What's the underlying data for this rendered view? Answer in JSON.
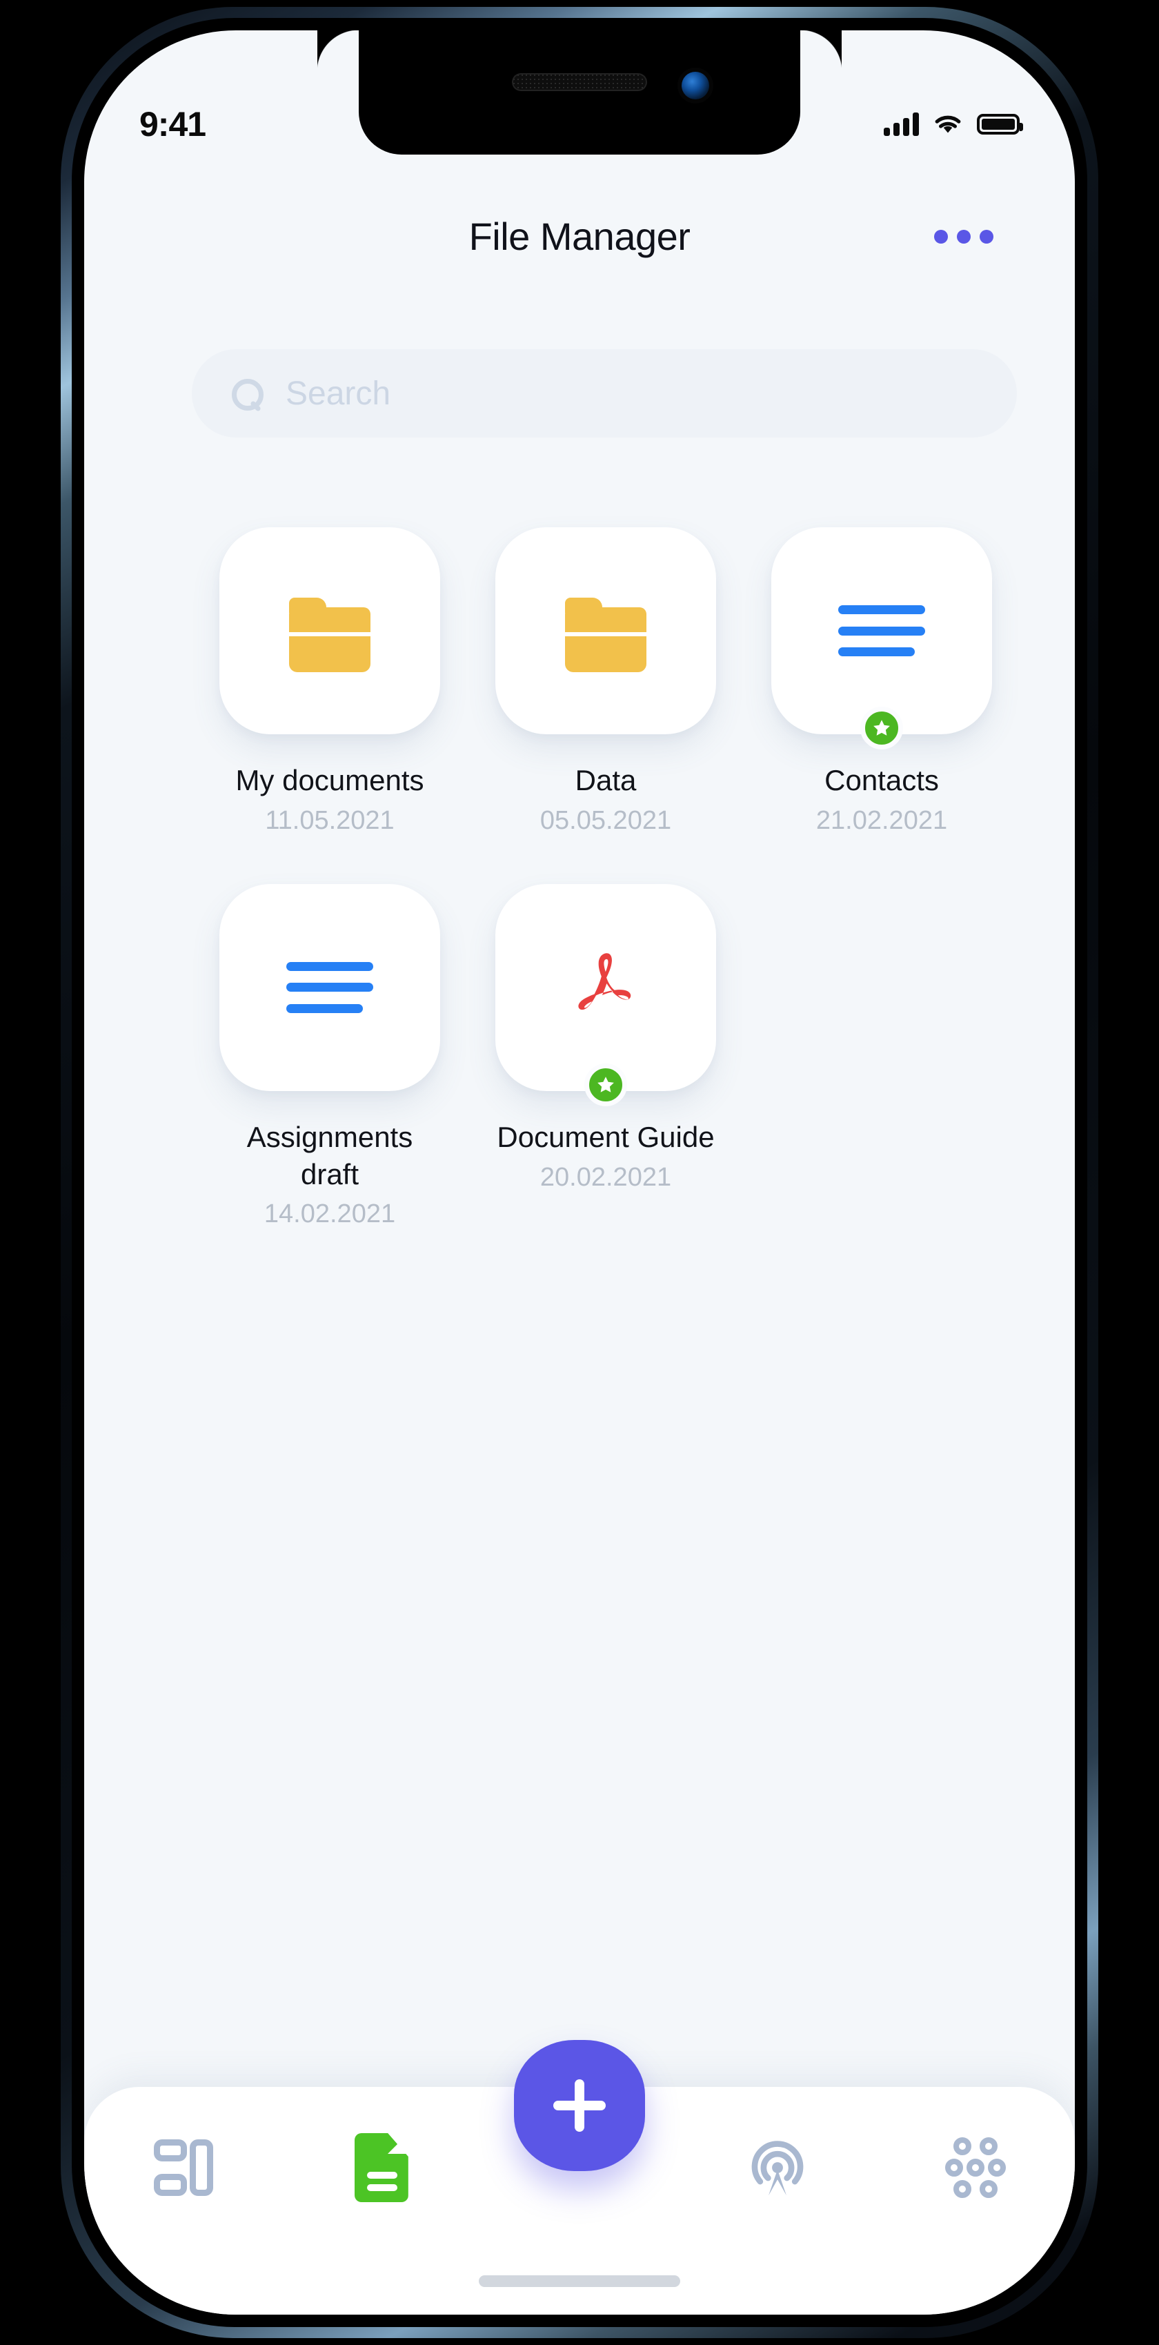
{
  "statusbar": {
    "time": "9:41",
    "cellular_icon": "signal-bars-icon",
    "wifi_icon": "wifi-icon",
    "battery_icon": "battery-full-icon"
  },
  "header": {
    "title": "File Manager",
    "more_icon": "more-options-icon"
  },
  "search": {
    "placeholder": "Search",
    "value": "",
    "icon": "search-icon"
  },
  "colors": {
    "accent": "#5B56E6",
    "folder": "#F2C14B",
    "lines": "#2680F5",
    "pdf": "#E8403F",
    "badge_green": "#4CB722",
    "doc_green": "#4CC425",
    "nav_inactive": "#A9B8D0",
    "screen_bg": "#F4F7FA",
    "card_bg": "#FFFFFF",
    "search_bg": "#EEF2F7",
    "text_primary": "#111319",
    "text_muted": "#B5BDC8"
  },
  "files": [
    {
      "name": "My documents",
      "date": "11.05.2021",
      "icon": "folder-icon",
      "starred": false
    },
    {
      "name": "Data",
      "date": "05.05.2021",
      "icon": "folder-icon",
      "starred": false
    },
    {
      "name": "Contacts",
      "date": "21.02.2021",
      "icon": "lines-list-icon",
      "starred": true
    },
    {
      "name": "Assignments draft",
      "date": "14.02.2021",
      "icon": "lines-list-icon",
      "starred": false
    },
    {
      "name": "Document Guide",
      "date": "20.02.2021",
      "icon": "pdf-icon",
      "starred": true
    }
  ],
  "navbar": {
    "items": [
      {
        "icon": "dashboard-icon",
        "active": false
      },
      {
        "icon": "document-icon",
        "active": true
      },
      {
        "icon": "broadcast-icon",
        "active": false
      },
      {
        "icon": "cluster-grid-icon",
        "active": false
      }
    ],
    "fab": {
      "icon": "plus-icon",
      "label": "+"
    }
  }
}
